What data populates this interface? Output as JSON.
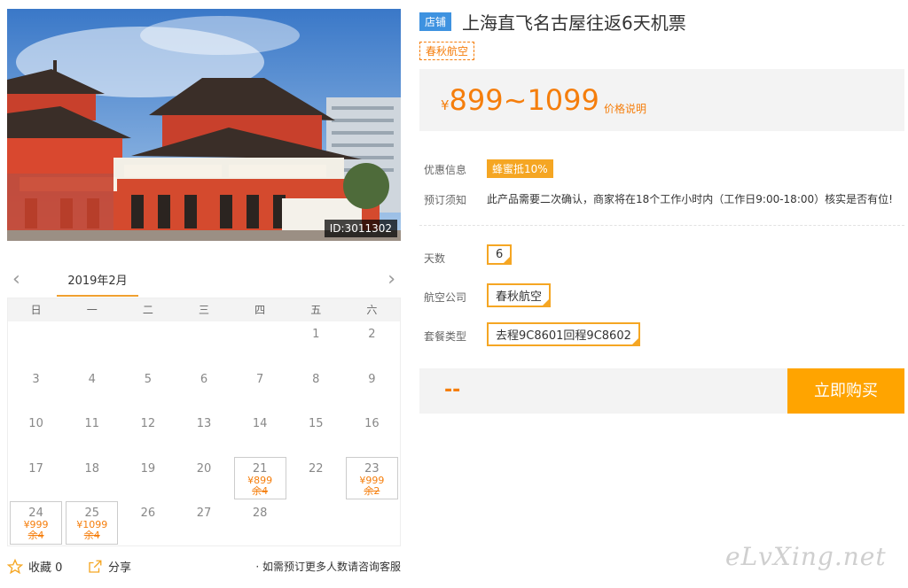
{
  "product": {
    "store_badge": "店铺",
    "title": "上海直飞名古屋往返6天机票",
    "airline_tag": "春秋航空",
    "image_id": "ID:3011302"
  },
  "price": {
    "currency": "¥",
    "range": "899~1099",
    "note": "价格说明"
  },
  "info": {
    "discount_label": "优惠信息",
    "discount_value": "蜂蜜抵10%",
    "notice_label": "预订须知",
    "notice_value": "此产品需要二次确认，商家将在18个工作小时内（工作日9:00-18:00）核实是否有位!"
  },
  "options": {
    "days_label": "天数",
    "days_value": "6",
    "airline_label": "航空公司",
    "airline_value": "春秋航空",
    "package_label": "套餐类型",
    "package_value": "去程9C8601回程9C8602"
  },
  "buy": {
    "total": "--",
    "button": "立即购买"
  },
  "calendar": {
    "month": "2019年2月",
    "weekdays": [
      "日",
      "一",
      "二",
      "三",
      "四",
      "五",
      "六"
    ],
    "prev_arrow": "‹",
    "next_arrow": "›",
    "cells": [
      {
        "day": ""
      },
      {
        "day": ""
      },
      {
        "day": ""
      },
      {
        "day": ""
      },
      {
        "day": ""
      },
      {
        "day": "1"
      },
      {
        "day": "2"
      },
      {
        "day": "3"
      },
      {
        "day": "4"
      },
      {
        "day": "5"
      },
      {
        "day": "6"
      },
      {
        "day": "7"
      },
      {
        "day": "8"
      },
      {
        "day": "9"
      },
      {
        "day": "10"
      },
      {
        "day": "11"
      },
      {
        "day": "12"
      },
      {
        "day": "13"
      },
      {
        "day": "14"
      },
      {
        "day": "15"
      },
      {
        "day": "16"
      },
      {
        "day": "17"
      },
      {
        "day": "18"
      },
      {
        "day": "19"
      },
      {
        "day": "20"
      },
      {
        "day": "21",
        "price": "¥899",
        "remain": "余4"
      },
      {
        "day": "22"
      },
      {
        "day": "23",
        "price": "¥999",
        "remain": "余2"
      },
      {
        "day": "24",
        "price": "¥999",
        "remain": "余4"
      },
      {
        "day": "25",
        "price": "¥1099",
        "remain": "余4"
      },
      {
        "day": "26"
      },
      {
        "day": "27"
      },
      {
        "day": "28"
      },
      {
        "day": ""
      },
      {
        "day": ""
      }
    ]
  },
  "footer": {
    "favorite": "收藏 0",
    "share": "分享",
    "consult": "· 如需预订更多人数请咨询客服"
  },
  "watermark": "eLvXing.net"
}
